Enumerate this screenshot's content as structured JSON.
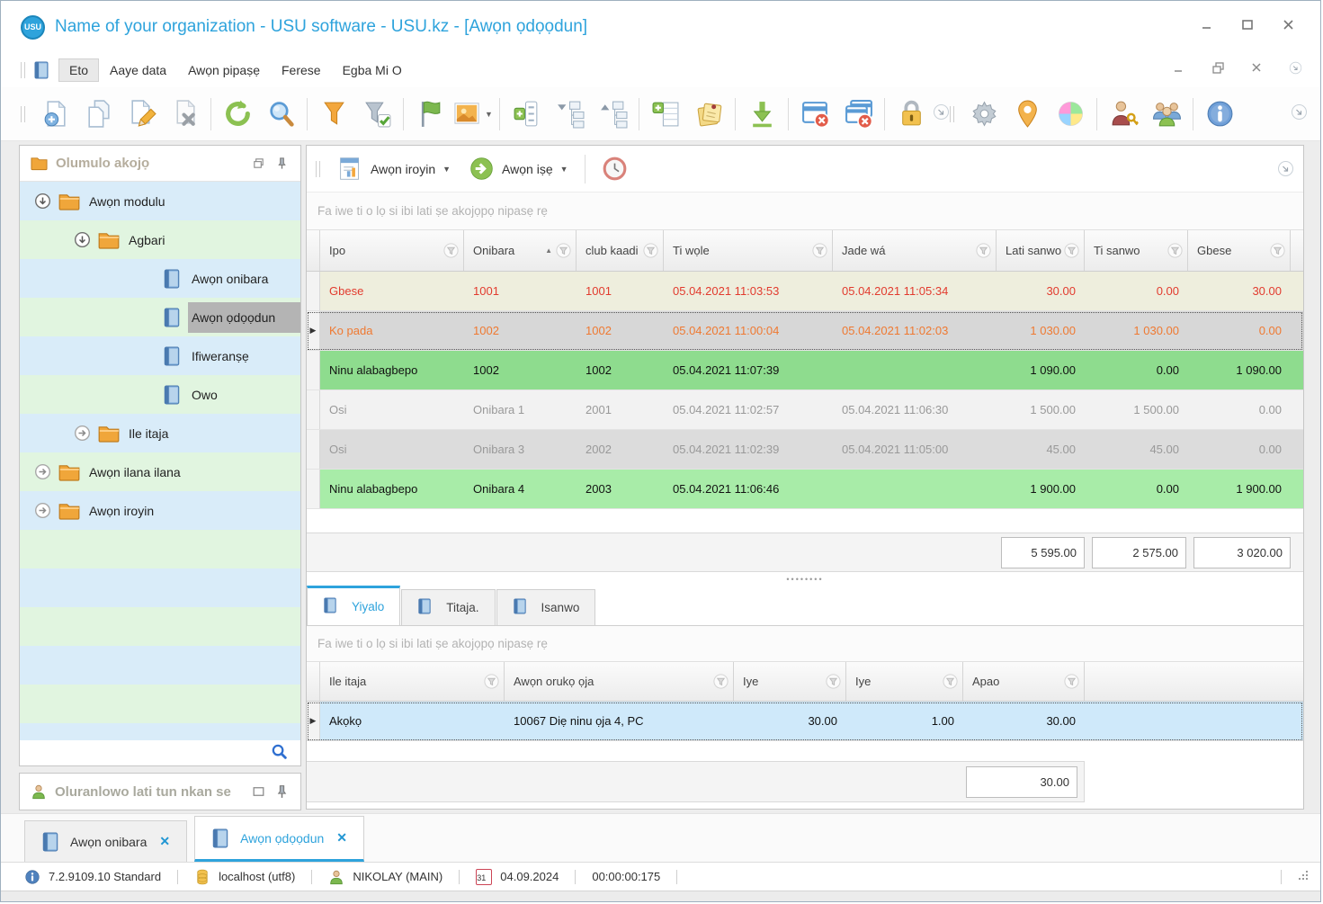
{
  "window": {
    "title": "Name of your organization - USU software - USU.kz - [Awọn ọdọọdun]",
    "logo_text": "USU",
    "controls": [
      "minimize",
      "maximize",
      "close"
    ]
  },
  "menu": {
    "items": [
      "Eto",
      "Aaye data",
      "Awọn pipaṣẹ",
      "Ferese",
      "Egba Mi O"
    ],
    "active_item": "Eto",
    "mdi_controls": [
      "minimize",
      "restore",
      "close",
      "overflow-chevron"
    ]
  },
  "toolbar": {
    "groups_left": [
      [
        "new-document",
        "copy-document",
        "edit-document",
        "delete-document"
      ],
      [
        "refresh",
        "search"
      ],
      [
        "filter",
        "filter-accept"
      ],
      [
        "flag",
        "picture"
      ],
      [
        "expand-rows",
        "tree-collapse",
        "tree-expand"
      ],
      [
        "add-row",
        "notes"
      ],
      [
        "export-download"
      ],
      [
        "close-window",
        "close-all-windows"
      ],
      [
        "lock"
      ]
    ],
    "groups_right": [
      [
        "settings-gear",
        "location-pin",
        "color-palette"
      ],
      [
        "user-permissions",
        "user-group"
      ],
      [
        "info"
      ]
    ]
  },
  "report_bar": {
    "reports_label": "Awọn iroyin",
    "actions_label": "Awọn iṣẹ",
    "icons": [
      "report-document",
      "go-arrow",
      "clock"
    ]
  },
  "sidebar": {
    "header": "Olumulo akojọ",
    "assistant_header": "Oluranlowo lati tun nkan se",
    "tree": [
      {
        "label": "Awọn modulu",
        "icon": "folder",
        "expander": "expanded",
        "depth": 0,
        "selected": false
      },
      {
        "label": "Agbari",
        "icon": "folder",
        "expander": "expanded",
        "depth": 1,
        "selected": false
      },
      {
        "label": "Awọn onibara",
        "icon": "book",
        "expander": "none",
        "depth": 2,
        "selected": false
      },
      {
        "label": "Awọn ọdọọdun",
        "icon": "book",
        "expander": "none",
        "depth": 2,
        "selected": true
      },
      {
        "label": "Ifiweranṣẹ",
        "icon": "book",
        "expander": "none",
        "depth": 2,
        "selected": false
      },
      {
        "label": "Owo",
        "icon": "book",
        "expander": "none",
        "depth": 2,
        "selected": false
      },
      {
        "label": "Ile itaja",
        "icon": "folder",
        "expander": "collapsed",
        "depth": 1,
        "selected": false
      },
      {
        "label": "Awọn ilana ilana",
        "icon": "folder",
        "expander": "collapsed",
        "depth": 0,
        "selected": false
      },
      {
        "label": "Awọn iroyin",
        "icon": "folder",
        "expander": "collapsed",
        "depth": 0,
        "selected": false
      }
    ]
  },
  "main_table": {
    "group_hint": "Fa iwe ti o lọ si ibi lati ṣe akojọpọ nipasẹ rẹ",
    "columns": [
      "Ipo",
      "Onibara",
      "club kaadi",
      "Ti wọle",
      "Jade wá",
      "Lati sanwo",
      "Ti sanwo",
      "Gbese"
    ],
    "sorted_column": "Onibara",
    "sort_direction": "asc",
    "rows": [
      {
        "cells": [
          "Gbese",
          "1001",
          "1001",
          "05.04.2021 11:03:53",
          "05.04.2021 11:05:34",
          "30.00",
          "0.00",
          "30.00"
        ],
        "bg": "#eeeedd",
        "fg": "#e23b2e",
        "focused": false
      },
      {
        "cells": [
          "Ko pada",
          "1002",
          "1002",
          "05.04.2021 11:00:04",
          "05.04.2021 11:02:03",
          "1 030.00",
          "1 030.00",
          "0.00"
        ],
        "bg": "#d7d7d7",
        "fg": "#ef7931",
        "focused": true
      },
      {
        "cells": [
          "Ninu alabagbepo",
          "1002",
          "1002",
          "05.04.2021 11:07:39",
          "",
          "1 090.00",
          "0.00",
          "1 090.00"
        ],
        "bg": "#8edc8e",
        "fg": "#111111",
        "focused": false
      },
      {
        "cells": [
          "Osi",
          "Onibara 1",
          "2001",
          "05.04.2021 11:02:57",
          "05.04.2021 11:06:30",
          "1 500.00",
          "1 500.00",
          "0.00"
        ],
        "bg": "#f2f2f2",
        "fg": "#999999",
        "focused": false
      },
      {
        "cells": [
          "Osi",
          "Onibara 3",
          "2002",
          "05.04.2021 11:02:39",
          "05.04.2021 11:05:00",
          "45.00",
          "45.00",
          "0.00"
        ],
        "bg": "#dcdcdc",
        "fg": "#999999",
        "focused": false
      },
      {
        "cells": [
          "Ninu alabagbepo",
          "Onibara 4",
          "2003",
          "05.04.2021 11:06:46",
          "",
          "1 900.00",
          "0.00",
          "1 900.00"
        ],
        "bg": "#a8eca8",
        "fg": "#111111",
        "focused": false
      }
    ],
    "totals": [
      "5 595.00",
      "2 575.00",
      "3 020.00"
    ]
  },
  "bottom_panel": {
    "tabs": [
      "Yiyalo",
      "Titaja.",
      "Isanwo"
    ],
    "active_tab": "Yiyalo",
    "group_hint": "Fa iwe ti o lọ si ibi lati ṣe akojọpọ nipasẹ rẹ",
    "columns": [
      "Ile itaja",
      "Awọn orukọ ọja",
      "Iye",
      "Iye",
      "Apao"
    ],
    "rows": [
      {
        "cells": [
          "Akọkọ",
          "10067 Diẹ ninu ọja 4, PC",
          "30.00",
          "1.00",
          "30.00"
        ],
        "bg": "#cfe9fa",
        "fg": "#111111",
        "focused": true
      }
    ],
    "total": "30.00"
  },
  "doc_tabs": [
    {
      "label": "Awọn onibara",
      "active": false
    },
    {
      "label": "Awọn ọdọọdun",
      "active": true
    }
  ],
  "status_bar": {
    "version": "7.2.9109.10 Standard",
    "database": "localhost (utf8)",
    "user": "NIKOLAY (MAIN)",
    "calendar_day": "31",
    "date": "04.09.2024",
    "timer": "00:00:00:175"
  },
  "colors": {
    "accent": "#2ea3dc",
    "tree_stripe_blue": "#d9ecf9",
    "tree_stripe_green": "#e1f5e0",
    "selected_node_bg": "#b4b4b4",
    "group_hint_text": "#b3b3b3",
    "row_debt": "#eeeedd",
    "row_not_returned": "#d7d7d7",
    "row_in_hall": "#8edc8e",
    "row_left": "#dcdcdc",
    "detail_row_selected": "#cfe9fa"
  }
}
